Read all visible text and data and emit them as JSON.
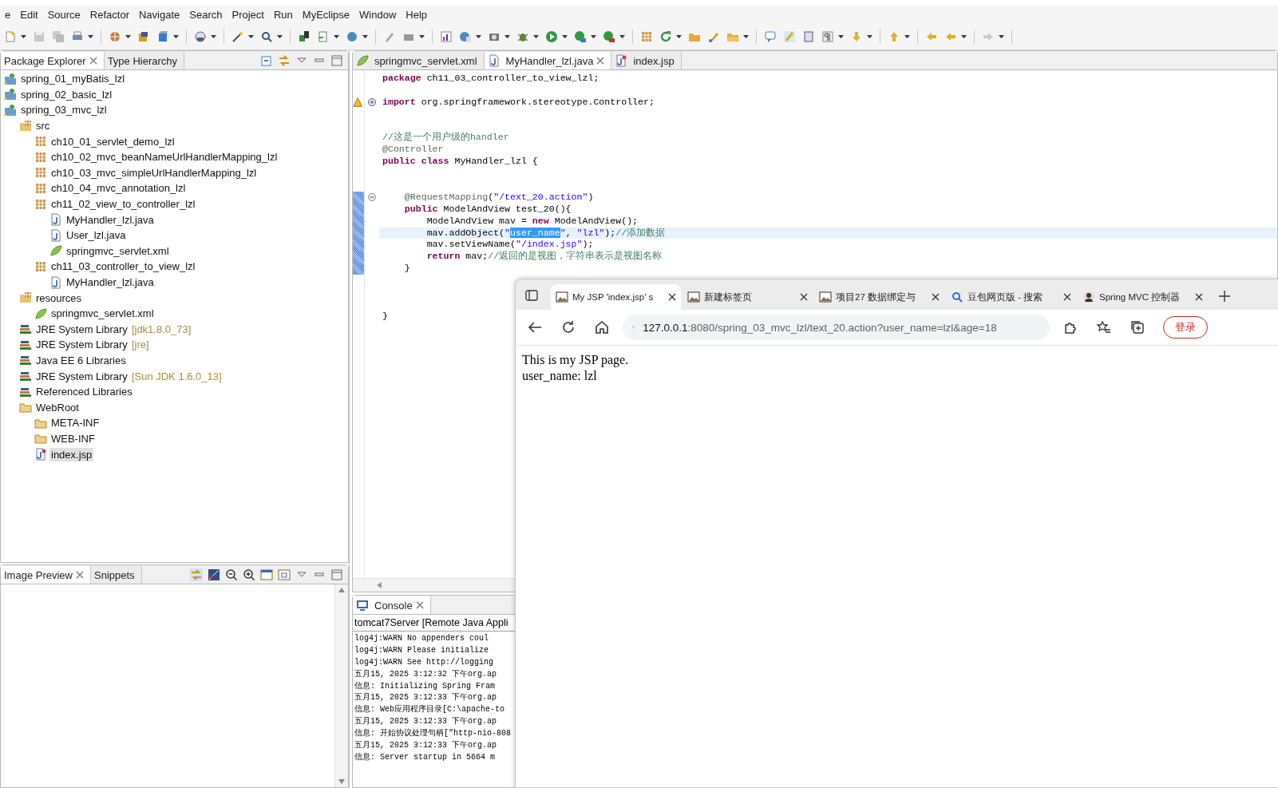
{
  "menu": [
    "e",
    "Edit",
    "Source",
    "Refactor",
    "Navigate",
    "Search",
    "Project",
    "Run",
    "MyEclipse",
    "Window",
    "Help"
  ],
  "explorer": {
    "tabs": [
      {
        "label": "Package Explorer",
        "selected": true,
        "closable": true
      },
      {
        "label": "Type Hierarchy",
        "selected": false,
        "closable": false
      }
    ],
    "tree": [
      {
        "kind": "project",
        "label": "spring_01_myBatis_lzl",
        "selected": false
      },
      {
        "kind": "project",
        "label": "spring_02_basic_lzl",
        "selected": false
      },
      {
        "kind": "project",
        "label": "spring_03_mvc_lzl",
        "selected": false,
        "children": [
          {
            "kind": "source-folder",
            "label": "src",
            "selected": false,
            "children": [
              {
                "kind": "package",
                "label": "ch10_01_servlet_demo_lzl",
                "selected": false
              },
              {
                "kind": "package",
                "label": "ch10_02_mvc_beanNameUrlHandlerMapping_lzl",
                "selected": false
              },
              {
                "kind": "package",
                "label": "ch10_03_mvc_simpleUrlHandlerMapping_lzl",
                "selected": false
              },
              {
                "kind": "package",
                "label": "ch10_04_mvc_annotation_lzl",
                "selected": false
              },
              {
                "kind": "package",
                "label": "ch11_02_view_to_controller_lzl",
                "selected": false,
                "children": [
                  {
                    "kind": "java-file",
                    "label": "MyHandler_lzl.java",
                    "selected": false
                  },
                  {
                    "kind": "java-file",
                    "label": "User_lzl.java",
                    "selected": false
                  },
                  {
                    "kind": "xml-file",
                    "label": "springmvc_servlet.xml",
                    "selected": false
                  }
                ]
              },
              {
                "kind": "package",
                "label": "ch11_03_controller_to_view_lzl",
                "selected": false,
                "children": [
                  {
                    "kind": "java-file",
                    "label": "MyHandler_lzl.java",
                    "selected": false
                  }
                ]
              }
            ]
          },
          {
            "kind": "source-folder",
            "label": "resources",
            "selected": false,
            "children": [
              {
                "kind": "xml-file",
                "label": "springmvc_servlet.xml",
                "selected": false
              }
            ]
          },
          {
            "kind": "library",
            "label": "JRE System Library",
            "detail": "[jdk1.8.0_73]",
            "selected": false
          },
          {
            "kind": "library",
            "label": "JRE System Library",
            "detail": "[jre]",
            "selected": false
          },
          {
            "kind": "library",
            "label": "Java EE 6 Libraries",
            "selected": false
          },
          {
            "kind": "library",
            "label": "JRE System Library",
            "detail": "[Sun JDK 1.6.0_13]",
            "selected": false
          },
          {
            "kind": "library",
            "label": "Referenced Libraries",
            "selected": false
          },
          {
            "kind": "folder",
            "label": "WebRoot",
            "selected": false,
            "children": [
              {
                "kind": "folder",
                "label": "META-INF",
                "selected": false
              },
              {
                "kind": "folder",
                "label": "WEB-INF",
                "selected": false
              },
              {
                "kind": "jsp-file",
                "label": "index.jsp",
                "selected": true
              }
            ]
          }
        ]
      }
    ]
  },
  "preview": {
    "tabs": [
      {
        "label": "Image Preview",
        "selected": true,
        "closable": true
      },
      {
        "label": "Snippets",
        "selected": false,
        "closable": false
      }
    ]
  },
  "editor": {
    "tabs": [
      {
        "label": "springmvc_servlet.xml",
        "kind": "xml-file",
        "selected": false,
        "closable": false
      },
      {
        "label": "MyHandler_lzl.java",
        "kind": "java-file",
        "selected": true,
        "closable": true
      },
      {
        "label": "index.jsp",
        "kind": "jsp-file",
        "selected": false,
        "closable": false
      }
    ],
    "lines": [
      {
        "kind": "code",
        "segments": [
          {
            "kind": "keyword",
            "text": "package"
          },
          {
            "kind": "plain",
            "text": " ch11_03_controller_to_view_lzl;"
          }
        ]
      },
      {
        "kind": "blank"
      },
      {
        "kind": "code",
        "folded": true,
        "warning": true,
        "segments": [
          {
            "kind": "keyword",
            "text": "import"
          },
          {
            "kind": "plain",
            "text": " org.springframework.stereotype.Controller;"
          }
        ]
      },
      {
        "kind": "blank"
      },
      {
        "kind": "blank"
      },
      {
        "kind": "code",
        "segments": [
          {
            "kind": "comment",
            "text": "//这是一个用户级的handler"
          }
        ]
      },
      {
        "kind": "code",
        "segments": [
          {
            "kind": "annotation",
            "text": "@Controller"
          }
        ]
      },
      {
        "kind": "code",
        "segments": [
          {
            "kind": "keyword",
            "text": "public class"
          },
          {
            "kind": "plain",
            "text": " MyHandler_lzl {"
          }
        ]
      },
      {
        "kind": "blank"
      },
      {
        "kind": "blank"
      },
      {
        "kind": "code",
        "folded": false,
        "changed": true,
        "segments": [
          {
            "kind": "annotation",
            "text": "    @RequestMapping"
          },
          {
            "kind": "plain",
            "text": "("
          },
          {
            "kind": "string",
            "text": "\"/text_20.action\""
          },
          {
            "kind": "plain",
            "text": ")"
          }
        ]
      },
      {
        "kind": "code",
        "changed": true,
        "segments": [
          {
            "kind": "keyword",
            "text": "    public"
          },
          {
            "kind": "plain",
            "text": " ModelAndView test_20(){"
          }
        ]
      },
      {
        "kind": "code",
        "changed": true,
        "segments": [
          {
            "kind": "plain",
            "text": "        ModelAndView mav = "
          },
          {
            "kind": "keyword",
            "text": "new"
          },
          {
            "kind": "plain",
            "text": " ModelAndView();"
          }
        ]
      },
      {
        "kind": "code",
        "changed": true,
        "current": true,
        "segments": [
          {
            "kind": "plain",
            "text": "        mav.addObject("
          },
          {
            "kind": "string",
            "text": "\""
          },
          {
            "kind": "selection",
            "text": "user_name"
          },
          {
            "kind": "string",
            "text": "\""
          },
          {
            "kind": "plain",
            "text": ", "
          },
          {
            "kind": "string",
            "text": "\"lzl\""
          },
          {
            "kind": "plain",
            "text": ");"
          },
          {
            "kind": "comment",
            "text": "//添加数据"
          }
        ]
      },
      {
        "kind": "code",
        "changed": true,
        "segments": [
          {
            "kind": "plain",
            "text": "        mav.setViewName("
          },
          {
            "kind": "string",
            "text": "\"/index.jsp\""
          },
          {
            "kind": "plain",
            "text": ");"
          }
        ]
      },
      {
        "kind": "code",
        "changed": true,
        "segments": [
          {
            "kind": "keyword",
            "text": "        return"
          },
          {
            "kind": "plain",
            "text": " mav;"
          },
          {
            "kind": "comment",
            "text": "//返回的是视图，字符串表示是视图名称"
          }
        ]
      },
      {
        "kind": "code",
        "changed": true,
        "segments": [
          {
            "kind": "plain",
            "text": "    }"
          }
        ]
      },
      {
        "kind": "blank"
      },
      {
        "kind": "blank"
      },
      {
        "kind": "blank"
      },
      {
        "kind": "code",
        "segments": [
          {
            "kind": "plain",
            "text": "}"
          }
        ]
      }
    ]
  },
  "console": {
    "tab": {
      "label": "Console",
      "selected": true,
      "closable": true
    },
    "header": "tomcat7Server [Remote Java Appli",
    "lines": [
      "log4j:WARN No appenders coul",
      "log4j:WARN Please initialize",
      "log4j:WARN See http://logging",
      "五月15, 2025 3:12:32 下午org.ap",
      "信息: Initializing Spring Fram",
      "五月15, 2025 3:12:33 下午org.ap",
      "信息: Web应用程序目录[C:\\apache-to",
      "五月15, 2025 3:12:33 下午org.ap",
      "信息: 开始协议处理句柄[\"http-nio-808",
      "五月15, 2025 3:12:33 下午org.ap",
      "信息: Server startup in 5664 m"
    ]
  },
  "browser": {
    "tabs": [
      {
        "title": "My JSP 'index.jsp' s",
        "selected": true
      },
      {
        "title": "新建标签页",
        "selected": false
      },
      {
        "title": "项目27 数据绑定与",
        "selected": false
      },
      {
        "title": "豆包网页版 - 搜索",
        "selected": false
      },
      {
        "title": "Spring MVC 控制器",
        "selected": false
      }
    ],
    "address": {
      "host": "127.0.0.1",
      "rest": ":8080/spring_03_mvc_lzl/text_20.action?user_name=lzl&age=18"
    },
    "login": "登录",
    "content": [
      "This is my JSP page.",
      "user_name: lzl"
    ]
  }
}
